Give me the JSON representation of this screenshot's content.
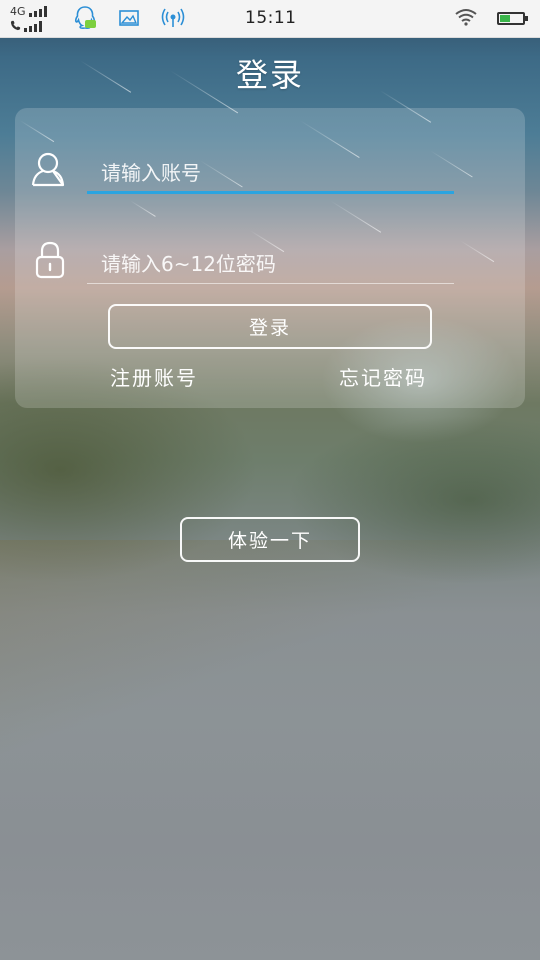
{
  "status_bar": {
    "network_label": "4G",
    "time": "15:11",
    "icons": [
      "qq-chat-icon",
      "image-icon",
      "signal-tower-icon",
      "wifi-icon",
      "battery-icon"
    ],
    "battery_level": 0.4,
    "battery_color": "#3ab54a"
  },
  "page": {
    "title": "登录"
  },
  "login_form": {
    "username": {
      "placeholder": "请输入账号",
      "value": "",
      "icon": "user-icon",
      "active_underline_color": "#2aa4e0"
    },
    "password": {
      "placeholder": "请输入6~12位密码",
      "value": "",
      "icon": "lock-icon"
    },
    "login_button_label": "登录",
    "register_link": "注册账号",
    "forgot_link": "忘记密码"
  },
  "try_button_label": "体验一下"
}
